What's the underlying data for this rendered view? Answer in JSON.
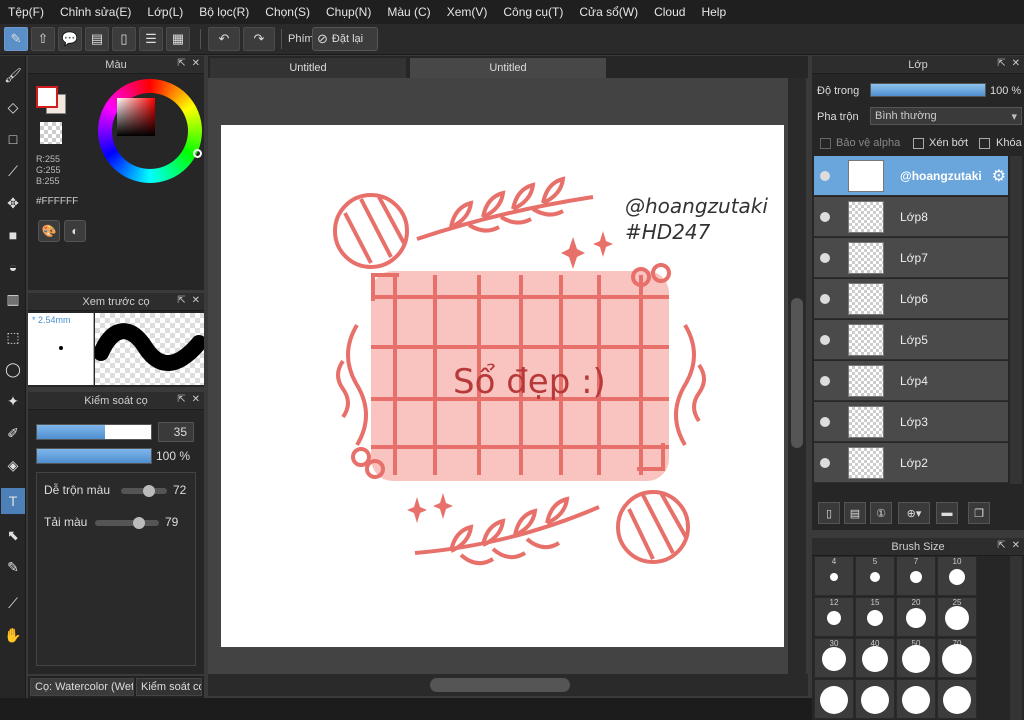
{
  "menu": [
    "Tệp(F)",
    "Chỉnh sửa(E)",
    "Lớp(L)",
    "Bộ lọc(R)",
    "Chọn(S)",
    "Chụp(N)",
    "Màu (C)",
    "Xem(V)",
    "Công cụ(T)",
    "Cửa sổ(W)",
    "Cloud",
    "Help"
  ],
  "toolbar": {
    "key_label": "Phím",
    "reset_label": "Đặt lại"
  },
  "color_panel": {
    "title": "Màu",
    "r": "R:255",
    "g": "G:255",
    "b": "B:255",
    "hex": "#FFFFFF"
  },
  "preview_panel": {
    "title": "Xem trước cọ",
    "size": "* 2.54mm"
  },
  "brush_control": {
    "title": "Kiểm soát cọ",
    "size_value": "35",
    "size_fraction": 0.6,
    "opacity_label": "100 %",
    "opacity_fraction": 1.0,
    "blend_label": "Dễ trộn màu",
    "blend_value": "72",
    "load_label": "Tải màu",
    "load_value": "79"
  },
  "bottom_tabs": [
    "Cọ: Watercolor (Wet)",
    "Kiểm soát cọ"
  ],
  "doc_tabs": [
    "Untitled",
    "Untitled"
  ],
  "artwork": {
    "handle": "@hoangzutaki",
    "tag": "#HD247",
    "title": "Sổ đẹp :)"
  },
  "layer_panel": {
    "title": "Lớp",
    "opacity_label": "Độ trong",
    "opacity_value": "100 %",
    "blend_label": "Pha trộn",
    "blend_value": "Bình thường",
    "protect_alpha": "Bảo vệ alpha",
    "clipping": "Xén bớt",
    "lock": "Khóa",
    "layers": [
      "@hoangzutaki",
      "Lớp8",
      "Lớp7",
      "Lớp6",
      "Lớp5",
      "Lớp4",
      "Lớp3",
      "Lớp2"
    ]
  },
  "brush_size": {
    "title": "Brush Size",
    "labels": [
      "4",
      "5",
      "7",
      "10",
      "12",
      "15",
      "20",
      "25",
      "30",
      "40",
      "50",
      "70"
    ]
  },
  "colors": {
    "accent": "#4f8fd0",
    "art": "#e8706a",
    "art_fill": "#f9c4c0"
  }
}
